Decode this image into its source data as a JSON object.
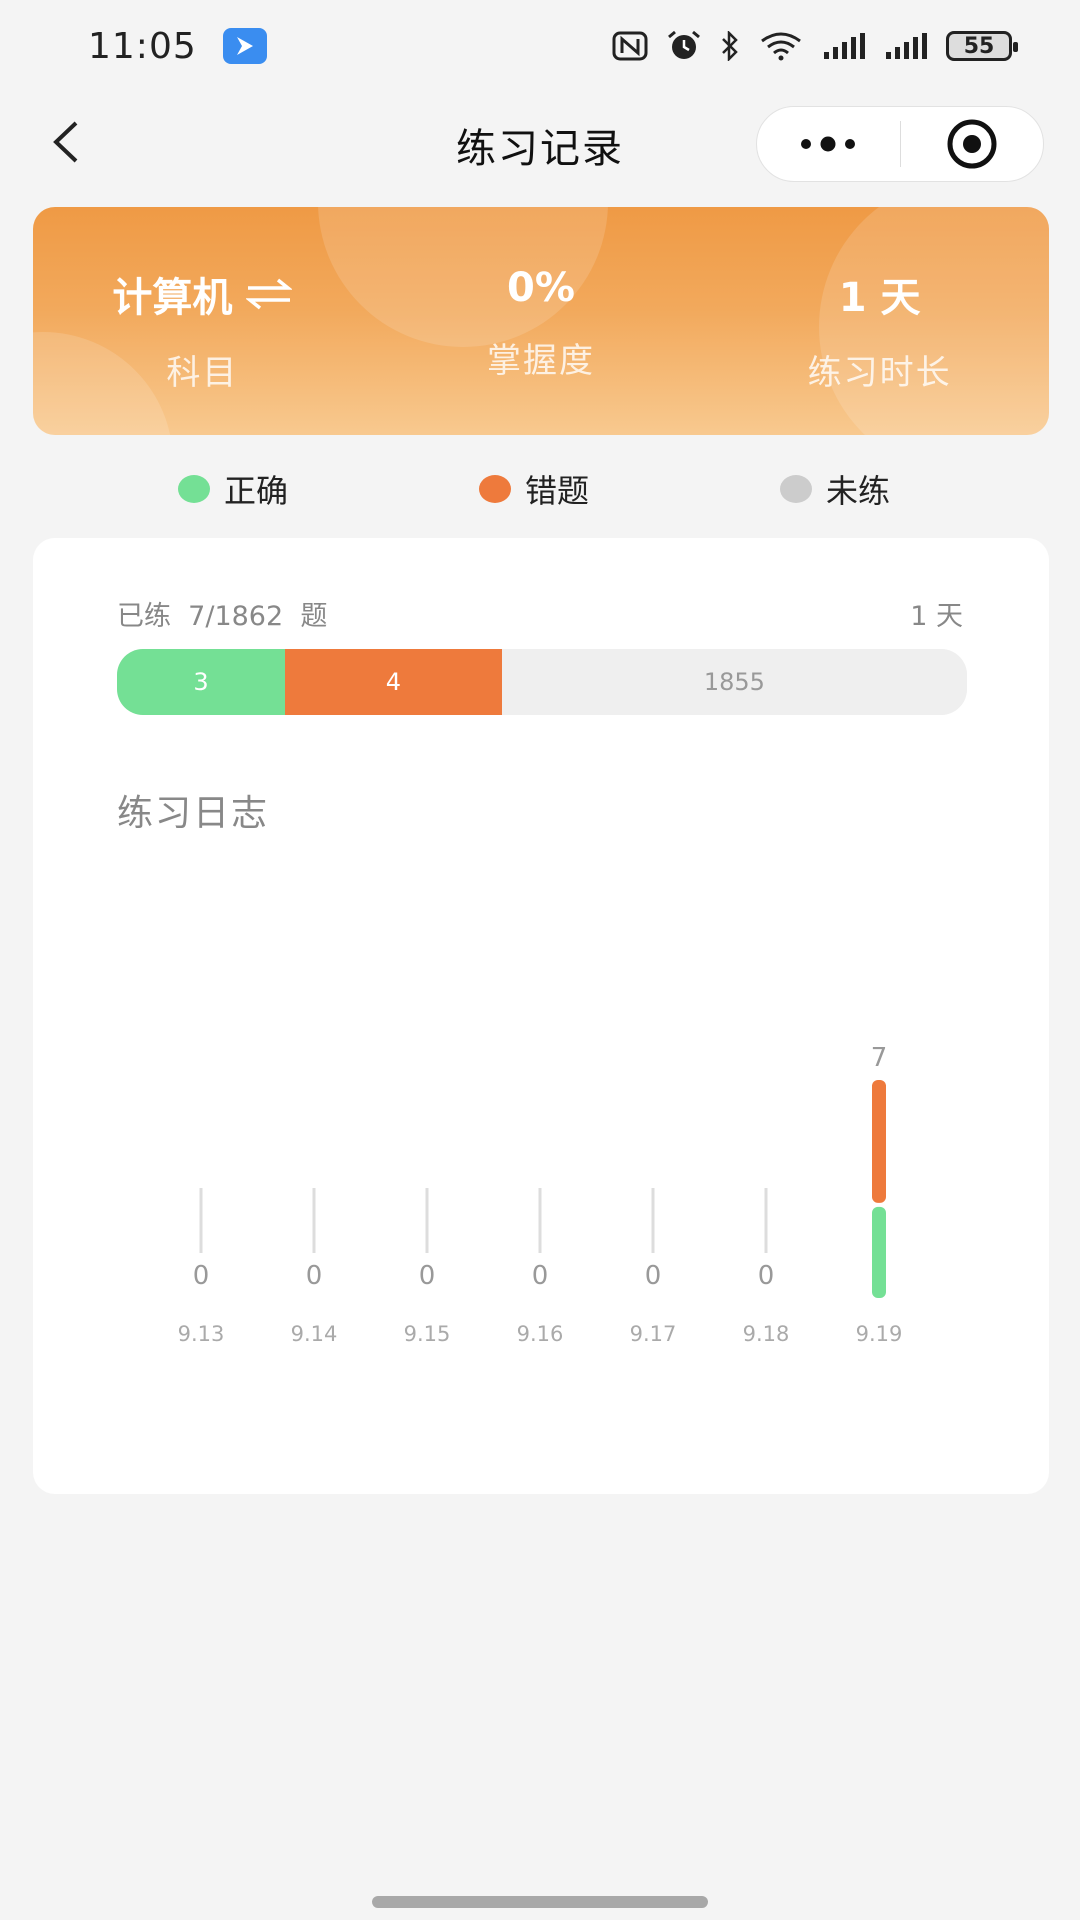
{
  "status_bar": {
    "time": "11:05",
    "battery": "55",
    "icons": [
      "app-badge-icon",
      "nfc-icon",
      "alarm-icon",
      "bluetooth-icon",
      "wifi-icon",
      "signal-icon",
      "signal-icon",
      "battery-icon"
    ]
  },
  "nav": {
    "title": "练习记录",
    "back_icon": "chevron-left-icon",
    "menu_icon": "more-dots-icon",
    "close_icon": "target-circle-icon"
  },
  "summary": {
    "subject_value": "计算机",
    "subject_label": "科目",
    "switch_icon": "swap-arrows-icon",
    "mastery_value": "0%",
    "mastery_label": "掌握度",
    "duration_value": "1 天",
    "duration_label": "练习时长"
  },
  "legend": {
    "correct": "正确",
    "wrong": "错题",
    "unpracticed": "未练"
  },
  "colors": {
    "correct": "#74e095",
    "wrong": "#ee7a3c",
    "unpracticed": "#cccccc",
    "accent": "#ef9a45"
  },
  "practice": {
    "practiced_text": "已练  7/1862  题",
    "days_text": "1 天",
    "correct_count": "3",
    "wrong_count": "4",
    "remaining_count": "1855",
    "correct_value": 3,
    "wrong_value": 4,
    "total_value": 1862
  },
  "log": {
    "title": "练习日志"
  },
  "chart_data": {
    "type": "bar",
    "stacked": true,
    "categories": [
      "9.13",
      "9.14",
      "9.15",
      "9.16",
      "9.17",
      "9.18",
      "9.19"
    ],
    "series": [
      {
        "name": "正确",
        "values": [
          0,
          0,
          0,
          0,
          0,
          0,
          3
        ]
      },
      {
        "name": "错题",
        "values": [
          0,
          0,
          0,
          0,
          0,
          0,
          4
        ]
      }
    ],
    "totals": [
      "0",
      "0",
      "0",
      "0",
      "0",
      "0",
      "7"
    ],
    "ylim": [
      0,
      7
    ],
    "grid": false
  }
}
